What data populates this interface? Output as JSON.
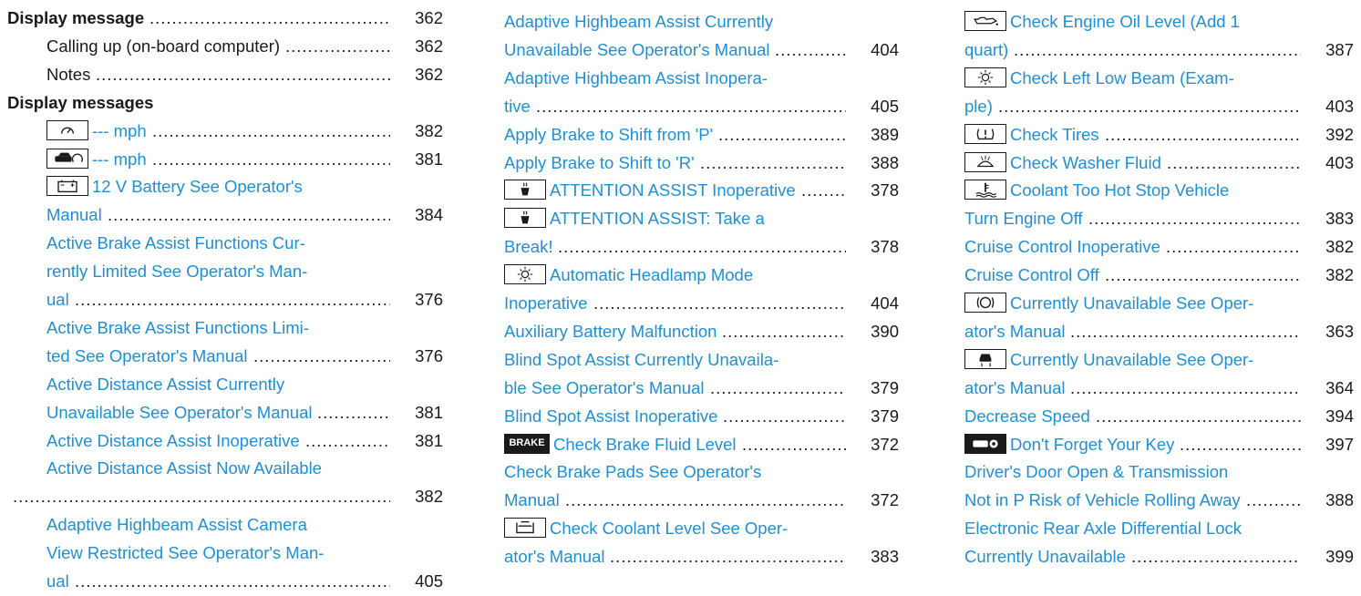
{
  "col1": [
    {
      "text": "Display message",
      "page": "362",
      "style": "bold",
      "dots": true
    },
    {
      "text": "Calling up (on-board computer)",
      "page": "362",
      "style": "plain",
      "dots": true
    },
    {
      "text": "Notes",
      "page": "362",
      "style": "plain",
      "dots": true
    },
    {
      "text": "Display messages",
      "page": "",
      "style": "bold",
      "dots": false
    },
    {
      "text": "--- mph",
      "page": "382",
      "style": "link",
      "dots": true,
      "icon": "speedometer-icon"
    },
    {
      "text": "--- mph",
      "page": "381",
      "style": "link",
      "dots": true,
      "icon": "distance-assist-icon"
    },
    {
      "text": "12 V Battery See Operator's",
      "page": "",
      "style": "link",
      "dots": false,
      "icon": "battery-icon"
    },
    {
      "text": "Manual",
      "page": "384",
      "style": "link",
      "dots": true
    },
    {
      "text": "Active Brake Assist Functions Cur-",
      "page": "",
      "style": "link",
      "dots": false
    },
    {
      "text": "rently Limited See Operator's Man-",
      "page": "",
      "style": "link",
      "dots": false
    },
    {
      "text": "ual",
      "page": "376",
      "style": "link",
      "dots": true
    },
    {
      "text": "Active Brake Assist Functions Limi-",
      "page": "",
      "style": "link",
      "dots": false
    },
    {
      "text": "ted See Operator's Manual",
      "page": "376",
      "style": "link",
      "dots": true
    },
    {
      "text": "Active Distance Assist Currently",
      "page": "",
      "style": "link",
      "dots": false
    },
    {
      "text": "Unavailable See Operator's Manual",
      "page": "381",
      "style": "link",
      "dots": true
    },
    {
      "text": "Active Distance Assist Inoperative",
      "page": "381",
      "style": "link",
      "dots": true
    },
    {
      "text": "Active Distance Assist Now Available",
      "page": "",
      "style": "link",
      "dots": false
    },
    {
      "text": "",
      "page": "382",
      "style": "link",
      "dots": true
    },
    {
      "text": "Adaptive Highbeam Assist Camera",
      "page": "",
      "style": "link",
      "dots": false
    },
    {
      "text": "View Restricted See Operator's Man-",
      "page": "",
      "style": "link",
      "dots": false
    },
    {
      "text": "ual",
      "page": "405",
      "style": "link",
      "dots": true
    }
  ],
  "col2": [
    {
      "text": "Adaptive Highbeam Assist Currently",
      "page": "",
      "style": "link",
      "dots": false
    },
    {
      "text": "Unavailable See Operator's Manual",
      "page": "404",
      "style": "link",
      "dots": true
    },
    {
      "text": "Adaptive Highbeam Assist Inopera-",
      "page": "",
      "style": "link",
      "dots": false
    },
    {
      "text": "tive",
      "page": "405",
      "style": "link",
      "dots": true
    },
    {
      "text": "Apply Brake to Shift from 'P'",
      "page": "389",
      "style": "link",
      "dots": true
    },
    {
      "text": "Apply Brake to Shift to 'R'",
      "page": "388",
      "style": "link",
      "dots": true
    },
    {
      "text": "ATTENTION ASSIST Inoperative",
      "page": "378",
      "style": "link",
      "dots": true,
      "icon": "coffee-cup-icon"
    },
    {
      "text": "ATTENTION ASSIST: Take a",
      "page": "",
      "style": "link",
      "dots": false,
      "icon": "coffee-cup-icon"
    },
    {
      "text": "Break!",
      "page": "378",
      "style": "link",
      "dots": true
    },
    {
      "text": "Automatic Headlamp Mode",
      "page": "",
      "style": "link",
      "dots": false,
      "icon": "headlamp-icon"
    },
    {
      "text": "Inoperative",
      "page": "404",
      "style": "link",
      "dots": true
    },
    {
      "text": "Auxiliary Battery Malfunction",
      "page": "390",
      "style": "link",
      "dots": true
    },
    {
      "text": "Blind Spot Assist Currently Unavaila-",
      "page": "",
      "style": "link",
      "dots": false
    },
    {
      "text": "ble See Operator's Manual",
      "page": "379",
      "style": "link",
      "dots": true
    },
    {
      "text": "Blind Spot Assist Inoperative",
      "page": "379",
      "style": "link",
      "dots": true
    },
    {
      "text": "Check Brake Fluid Level",
      "page": "372",
      "style": "link",
      "dots": true,
      "icon": "brake-icon",
      "icon_text": "BRAKE"
    },
    {
      "text": "Check Brake Pads See Operator's",
      "page": "",
      "style": "link",
      "dots": false
    },
    {
      "text": "Manual",
      "page": "372",
      "style": "link",
      "dots": true
    },
    {
      "text": "Check Coolant Level See Oper-",
      "page": "",
      "style": "link",
      "dots": false,
      "icon": "coolant-reservoir-icon"
    },
    {
      "text": "ator's Manual",
      "page": "383",
      "style": "link",
      "dots": true
    }
  ],
  "col3": [
    {
      "text": "Check Engine Oil Level (Add 1",
      "page": "",
      "style": "link",
      "dots": false,
      "icon": "oil-can-icon"
    },
    {
      "text": "quart)",
      "page": "387",
      "style": "link",
      "dots": true
    },
    {
      "text": "Check Left Low Beam (Exam-",
      "page": "",
      "style": "link",
      "dots": false,
      "icon": "lamp-icon"
    },
    {
      "text": "ple)",
      "page": "403",
      "style": "link",
      "dots": true
    },
    {
      "text": "Check Tires",
      "page": "392",
      "style": "link",
      "dots": true,
      "icon": "tire-pressure-icon"
    },
    {
      "text": "Check Washer Fluid",
      "page": "403",
      "style": "link",
      "dots": true,
      "icon": "washer-fluid-icon"
    },
    {
      "text": "Coolant Too Hot Stop Vehicle",
      "page": "",
      "style": "link",
      "dots": false,
      "icon": "coolant-temperature-icon"
    },
    {
      "text": "Turn Engine Off",
      "page": "383",
      "style": "link",
      "dots": true
    },
    {
      "text": "Cruise Control Inoperative",
      "page": "382",
      "style": "link",
      "dots": true
    },
    {
      "text": "Cruise Control Off",
      "page": "382",
      "style": "link",
      "dots": true
    },
    {
      "text": "Currently Unavailable See Oper-",
      "page": "",
      "style": "link",
      "dots": false,
      "icon": "abs-icon"
    },
    {
      "text": "ator's Manual",
      "page": "363",
      "style": "link",
      "dots": true
    },
    {
      "text": "Currently Unavailable See Oper-",
      "page": "",
      "style": "link",
      "dots": false,
      "icon": "skid-car-icon"
    },
    {
      "text": "ator's Manual",
      "page": "364",
      "style": "link",
      "dots": true
    },
    {
      "text": "Decrease Speed",
      "page": "394",
      "style": "link",
      "dots": true
    },
    {
      "text": "Don't Forget Your Key",
      "page": "397",
      "style": "link",
      "dots": true,
      "icon": "key-icon"
    },
    {
      "text": "Driver's Door Open & Transmission",
      "page": "",
      "style": "link",
      "dots": false
    },
    {
      "text": "Not in P Risk of Vehicle Rolling Away",
      "page": "388",
      "style": "link",
      "dots": true
    },
    {
      "text": "Electronic Rear Axle Differential Lock",
      "page": "",
      "style": "link",
      "dots": false
    },
    {
      "text": "Currently Unavailable",
      "page": "399",
      "style": "link",
      "dots": true
    }
  ]
}
